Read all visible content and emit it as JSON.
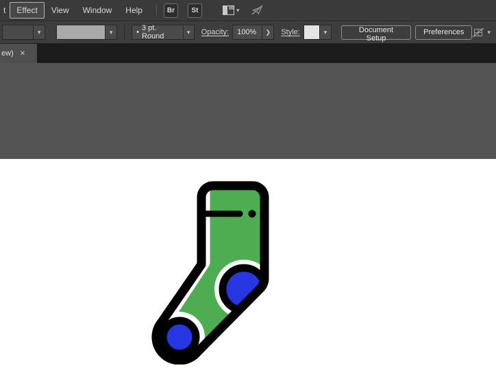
{
  "colors": {
    "menubar-bg": "#3a3a3a",
    "bar-bg": "#3d3d3d",
    "tabbar-bg": "#1b1b1b",
    "tab-bg": "#4e4e4e",
    "pasteboard": "#545454",
    "artboard": "#ffffff",
    "field-bg": "#4a4a4a",
    "field-border": "#282828",
    "swatch-light": "#a9a9a9",
    "text-light": "#d9d9d9",
    "button-border": "#909090",
    "sock-green": "#4cae50",
    "sock-blue": "#2636e3",
    "sock-outline": "#000000"
  },
  "menubar": {
    "items": [
      {
        "label": "t"
      },
      {
        "label": "Effect"
      },
      {
        "label": "View"
      },
      {
        "label": "Window"
      },
      {
        "label": "Help"
      }
    ],
    "tools": [
      {
        "label": "Br"
      },
      {
        "label": "St"
      }
    ]
  },
  "icons": {
    "chevron_down": "▾",
    "chevron_right": "❯",
    "close": "✕",
    "brush_dot": "•"
  },
  "controlbar": {
    "brush_name": "3 pt. Round",
    "opacity_label": "Opacity:",
    "opacity_value": "100%",
    "style_label": "Style:",
    "document_setup": "Document Setup",
    "preferences": "Preferences"
  },
  "tabbar": {
    "title": "ew)"
  }
}
